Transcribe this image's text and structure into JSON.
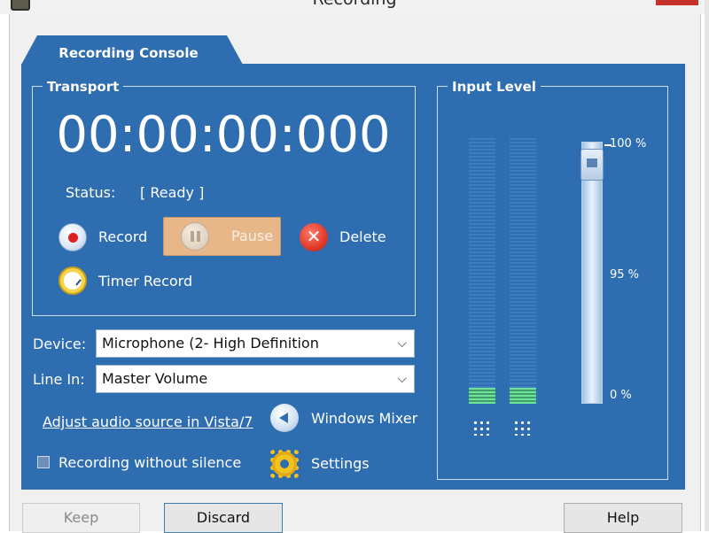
{
  "window": {
    "title": "Recording"
  },
  "tab": {
    "label": "Recording Console"
  },
  "transport": {
    "group_label": "Transport",
    "time": "00:00:00:000",
    "status_label": "Status:",
    "status_value": "[ Ready ]",
    "record_label": "Record",
    "pause_label": "Pause",
    "delete_label": "Delete",
    "timer_record_label": "Timer Record"
  },
  "device": {
    "device_label": "Device:",
    "device_value": "Microphone (2- High Definition",
    "line_in_label": "Line In:",
    "line_in_value": "Master Volume"
  },
  "links": {
    "adjust_source": "Adjust audio source in Vista/7",
    "windows_mixer": "Windows Mixer",
    "settings": "Settings"
  },
  "options": {
    "recording_without_silence": "Recording without silence",
    "recording_without_silence_checked": false
  },
  "input_level": {
    "group_label": "Input Level",
    "scale_top": "100 %",
    "scale_mid": "95 %",
    "scale_bottom": "0 %",
    "slider_value_percent": 100,
    "left_channel_level": 0.06,
    "right_channel_level": 0.06
  },
  "buttons": {
    "keep": "Keep",
    "discard": "Discard",
    "help": "Help"
  },
  "colors": {
    "panel": "#2d6db0",
    "pause_button": "#e7b78a",
    "meter_green": "#6fe39a",
    "close_red": "#c7312b"
  }
}
